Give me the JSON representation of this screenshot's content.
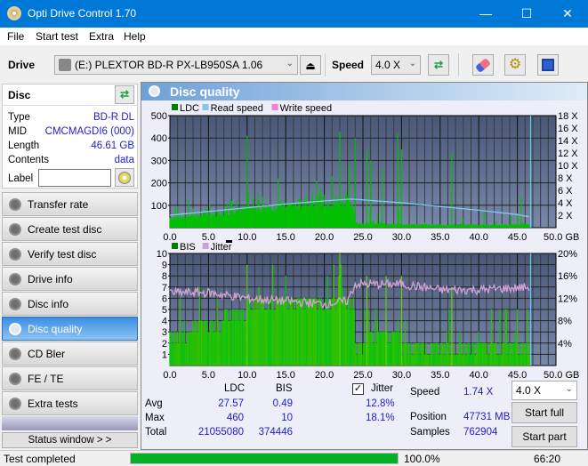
{
  "window": {
    "title": "Opti Drive Control 1.70",
    "minimize": "—",
    "maximize": "☐",
    "close": "✕"
  },
  "menu": [
    "File",
    "Start test",
    "Extra",
    "Help"
  ],
  "toolbar": {
    "drive_label": "Drive",
    "drive_value": "(E:)  PLEXTOR BD-R  PX-LB950SA 1.06",
    "speed_label": "Speed",
    "speed_value": "4.0 X"
  },
  "disc": {
    "header": "Disc",
    "type_label": "Type",
    "type_value": "BD-R DL",
    "mid_label": "MID",
    "mid_value": "CMCMAGDI6 (000)",
    "length_label": "Length",
    "length_value": "46.61 GB",
    "contents_label": "Contents",
    "contents_value": "data",
    "label_label": "Label",
    "label_value": ""
  },
  "nav": [
    {
      "label": "Transfer rate",
      "active": false
    },
    {
      "label": "Create test disc",
      "active": false
    },
    {
      "label": "Verify test disc",
      "active": false
    },
    {
      "label": "Drive info",
      "active": false
    },
    {
      "label": "Disc info",
      "active": false
    },
    {
      "label": "Disc quality",
      "active": true
    },
    {
      "label": "CD Bler",
      "active": false
    },
    {
      "label": "FE / TE",
      "active": false
    },
    {
      "label": "Extra tests",
      "active": false
    }
  ],
  "status_window_btn": "Status window > >",
  "panel": {
    "title": "Disc quality"
  },
  "colors": {
    "ldc": "#00c000",
    "read": "#80c8f0",
    "write": "#f080e0",
    "bis": "#00c000",
    "jitter": "#d0a0d0",
    "plot_bg_top": "#4a5878",
    "plot_bg_bottom": "#7888a8"
  },
  "chart_data": [
    {
      "type": "bar",
      "title": "LDC / Read speed",
      "legend": [
        "LDC",
        "Read speed",
        "Write speed"
      ],
      "xlabel": "GB",
      "xlim": [
        0,
        50
      ],
      "x_ticks": [
        "0.0",
        "5.0",
        "10.0",
        "15.0",
        "20.0",
        "25.0",
        "30.0",
        "35.0",
        "40.0",
        "45.0",
        "50.0 GB"
      ],
      "ylim": [
        0,
        500
      ],
      "y_ticks": [
        "500",
        "400",
        "300",
        "200",
        "100"
      ],
      "y2lim": [
        0,
        18
      ],
      "y2_ticks": [
        "18 X",
        "16 X",
        "14 X",
        "12 X",
        "10 X",
        "8 X",
        "6 X",
        "4 X",
        "2 X"
      ],
      "ldc_baseline": [
        [
          0,
          45
        ],
        [
          5,
          60
        ],
        [
          10,
          85
        ],
        [
          15,
          100
        ],
        [
          20,
          115
        ],
        [
          23.5,
          120
        ],
        [
          24,
          20
        ],
        [
          30,
          15
        ],
        [
          40,
          12
        ],
        [
          46.6,
          15
        ]
      ],
      "ldc_spikes": [
        [
          1,
          95
        ],
        [
          3,
          85
        ],
        [
          8,
          120
        ],
        [
          10,
          410
        ],
        [
          12,
          140
        ],
        [
          14,
          220
        ],
        [
          19,
          210
        ],
        [
          21,
          230
        ],
        [
          22,
          430
        ],
        [
          23.2,
          280
        ],
        [
          24,
          400
        ],
        [
          25.5,
          350
        ],
        [
          26,
          300
        ],
        [
          27.5,
          260
        ],
        [
          29.5,
          420
        ],
        [
          30,
          350
        ],
        [
          36.5,
          330
        ],
        [
          45.5,
          140
        ]
      ],
      "read_speed": [
        [
          0,
          2.0
        ],
        [
          5,
          2.6
        ],
        [
          10,
          3.2
        ],
        [
          15,
          3.8
        ],
        [
          20,
          4.3
        ],
        [
          23.5,
          4.6
        ],
        [
          30,
          4.0
        ],
        [
          35,
          3.4
        ],
        [
          40,
          2.8
        ],
        [
          45,
          2.1
        ],
        [
          46.6,
          1.74
        ]
      ],
      "end_marker_gb": 46.6
    },
    {
      "type": "bar",
      "title": "BIS / Jitter",
      "legend": [
        "BIS",
        "Jitter"
      ],
      "xlabel": "GB",
      "xlim": [
        0,
        50
      ],
      "x_ticks": [
        "0.0",
        "5.0",
        "10.0",
        "15.0",
        "20.0",
        "25.0",
        "30.0",
        "35.0",
        "40.0",
        "45.0",
        "50.0 GB"
      ],
      "ylim": [
        0,
        10
      ],
      "y_ticks": [
        "10",
        "9",
        "8",
        "7",
        "6",
        "5",
        "4",
        "3",
        "2",
        "1"
      ],
      "y2lim": [
        0,
        20
      ],
      "y2_ticks": [
        "20%",
        "16%",
        "12%",
        "8%",
        "4%"
      ],
      "bis_levels": [
        [
          0,
          3
        ],
        [
          3,
          4
        ],
        [
          7,
          5
        ],
        [
          10,
          6
        ],
        [
          23.5,
          5
        ],
        [
          24,
          2
        ],
        [
          25,
          3
        ],
        [
          30,
          2
        ],
        [
          46.6,
          2
        ]
      ],
      "jitter": [
        [
          0,
          13.0
        ],
        [
          5,
          13.0
        ],
        [
          10,
          12.0
        ],
        [
          15,
          11.5
        ],
        [
          20,
          11.0
        ],
        [
          23,
          11.5
        ],
        [
          24,
          14.5
        ],
        [
          30,
          14.5
        ],
        [
          35,
          13.5
        ],
        [
          40,
          13.5
        ],
        [
          46.6,
          14.0
        ]
      ],
      "end_marker_gb": 46.6
    }
  ],
  "stats": {
    "col_ldc": "LDC",
    "col_bis": "BIS",
    "jitter_label": "Jitter",
    "jitter_checked": true,
    "avg_label": "Avg",
    "avg_ldc": "27.57",
    "avg_bis": "0.49",
    "avg_jitter": "12.8%",
    "max_label": "Max",
    "max_ldc": "460",
    "max_bis": "10",
    "max_jitter": "18.1%",
    "total_label": "Total",
    "total_ldc": "21055080",
    "total_bis": "374446",
    "speed_label": "Speed",
    "speed_value": "1.74 X",
    "position_label": "Position",
    "position_value": "47731 MB",
    "samples_label": "Samples",
    "samples_value": "762904",
    "speed_select": "4.0 X",
    "start_full": "Start full",
    "start_part": "Start part"
  },
  "statusbar": {
    "text": "Test completed",
    "progress": 100.0,
    "progress_text": "100.0%",
    "time": "66:20"
  }
}
